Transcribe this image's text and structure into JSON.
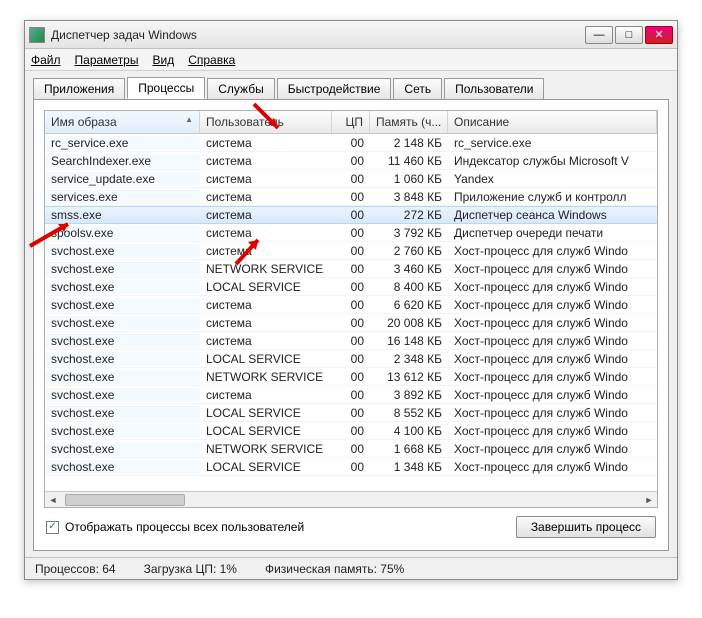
{
  "window": {
    "title": "Диспетчер задач Windows"
  },
  "menu": {
    "file": "Файл",
    "options": "Параметры",
    "view": "Вид",
    "help": "Справка"
  },
  "tabs": {
    "apps": "Приложения",
    "processes": "Процессы",
    "services": "Службы",
    "performance": "Быстродействие",
    "network": "Сеть",
    "users": "Пользователи"
  },
  "columns": {
    "image": "Имя образа",
    "user": "Пользователь",
    "cpu": "ЦП",
    "mem": "Память (ч...",
    "desc": "Описание"
  },
  "rows": [
    {
      "image": "rc_service.exe",
      "user": "система",
      "cpu": "00",
      "mem": "2 148 КБ",
      "desc": "rc_service.exe"
    },
    {
      "image": "SearchIndexer.exe",
      "user": "система",
      "cpu": "00",
      "mem": "11 460 КБ",
      "desc": "Индексатор службы Microsoft V"
    },
    {
      "image": "service_update.exe",
      "user": "система",
      "cpu": "00",
      "mem": "1 060 КБ",
      "desc": "Yandex"
    },
    {
      "image": "services.exe",
      "user": "система",
      "cpu": "00",
      "mem": "3 848 КБ",
      "desc": "Приложение служб и контролл"
    },
    {
      "image": "smss.exe",
      "user": "система",
      "cpu": "00",
      "mem": "272 КБ",
      "desc": "Диспетчер сеанса  Windows",
      "selected": true
    },
    {
      "image": "spoolsv.exe",
      "user": "система",
      "cpu": "00",
      "mem": "3 792 КБ",
      "desc": "Диспетчер очереди печати"
    },
    {
      "image": "svchost.exe",
      "user": "система",
      "cpu": "00",
      "mem": "2 760 КБ",
      "desc": "Хост-процесс для служб Windo"
    },
    {
      "image": "svchost.exe",
      "user": "NETWORK SERVICE",
      "cpu": "00",
      "mem": "3 460 КБ",
      "desc": "Хост-процесс для служб Windo"
    },
    {
      "image": "svchost.exe",
      "user": "LOCAL SERVICE",
      "cpu": "00",
      "mem": "8 400 КБ",
      "desc": "Хост-процесс для служб Windo"
    },
    {
      "image": "svchost.exe",
      "user": "система",
      "cpu": "00",
      "mem": "6 620 КБ",
      "desc": "Хост-процесс для служб Windo"
    },
    {
      "image": "svchost.exe",
      "user": "система",
      "cpu": "00",
      "mem": "20 008 КБ",
      "desc": "Хост-процесс для служб Windo"
    },
    {
      "image": "svchost.exe",
      "user": "система",
      "cpu": "00",
      "mem": "16 148 КБ",
      "desc": "Хост-процесс для служб Windo"
    },
    {
      "image": "svchost.exe",
      "user": "LOCAL SERVICE",
      "cpu": "00",
      "mem": "2 348 КБ",
      "desc": "Хост-процесс для служб Windo"
    },
    {
      "image": "svchost.exe",
      "user": "NETWORK SERVICE",
      "cpu": "00",
      "mem": "13 612 КБ",
      "desc": "Хост-процесс для служб Windo"
    },
    {
      "image": "svchost.exe",
      "user": "система",
      "cpu": "00",
      "mem": "3 892 КБ",
      "desc": "Хост-процесс для служб Windo"
    },
    {
      "image": "svchost.exe",
      "user": "LOCAL SERVICE",
      "cpu": "00",
      "mem": "8 552 КБ",
      "desc": "Хост-процесс для служб Windo"
    },
    {
      "image": "svchost.exe",
      "user": "LOCAL SERVICE",
      "cpu": "00",
      "mem": "4 100 КБ",
      "desc": "Хост-процесс для служб Windo"
    },
    {
      "image": "svchost.exe",
      "user": "NETWORK SERVICE",
      "cpu": "00",
      "mem": "1 668 КБ",
      "desc": "Хост-процесс для служб Windo"
    },
    {
      "image": "svchost.exe",
      "user": "LOCAL SERVICE",
      "cpu": "00",
      "mem": "1 348 КБ",
      "desc": "Хост-процесс для служб Windo"
    }
  ],
  "checkbox": {
    "label": "Отображать процессы всех пользователей",
    "checked": true
  },
  "buttons": {
    "end": "Завершить процесс"
  },
  "statusbar": {
    "processes": "Процессов: 64",
    "cpu": "Загрузка ЦП: 1%",
    "mem": "Физическая память: 75%"
  }
}
